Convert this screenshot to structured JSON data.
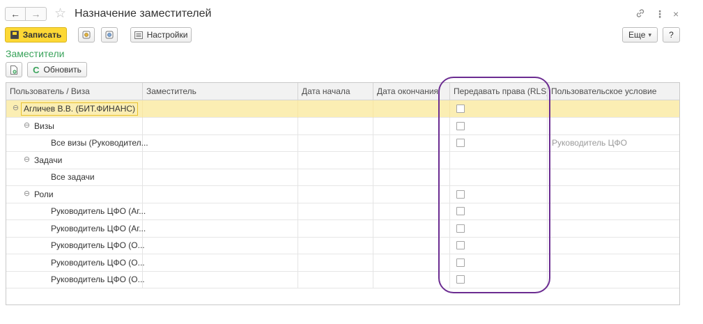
{
  "window": {
    "title": "Назначение заместителей",
    "back_icon": "←",
    "forward_icon": "→",
    "favorite_icon": "☆",
    "link_icon": "🔗",
    "menu_icon": "⋮",
    "close_icon": "×"
  },
  "toolbar": {
    "save_label": "Записать",
    "settings_label": "Настройки",
    "more_label": "Еще",
    "more_caret": "▾",
    "help_label": "?"
  },
  "section": {
    "title": "Заместители",
    "refresh_label": "Обновить",
    "refresh_icon": "C"
  },
  "table": {
    "columns": [
      "Пользователь / Виза",
      "Заместитель",
      "Дата начала",
      "Дата окончания",
      "Передавать права (RLS)",
      "Пользовательское условие"
    ],
    "collapse_icon": "⊖",
    "rows": [
      {
        "label": "Агличев В.В. (БИТ.ФИНАНС)",
        "level": 0,
        "collapse": true,
        "checkbox": true,
        "condition": "",
        "selected": true
      },
      {
        "label": "Визы",
        "level": 1,
        "collapse": true,
        "checkbox": true,
        "condition": "",
        "selected": false
      },
      {
        "label": "Все визы (Руководител...",
        "level": 2,
        "collapse": false,
        "checkbox": true,
        "condition": "Руководитель ЦФО",
        "selected": false
      },
      {
        "label": "Задачи",
        "level": 1,
        "collapse": true,
        "checkbox": false,
        "condition": "",
        "selected": false
      },
      {
        "label": "Все задачи",
        "level": 2,
        "collapse": false,
        "checkbox": false,
        "condition": "",
        "selected": false
      },
      {
        "label": "Роли",
        "level": 1,
        "collapse": true,
        "checkbox": true,
        "condition": "",
        "selected": false
      },
      {
        "label": "Руководитель ЦФО (Аг...",
        "level": 2,
        "collapse": false,
        "checkbox": true,
        "condition": "",
        "selected": false
      },
      {
        "label": "Руководитель ЦФО (Аг...",
        "level": 2,
        "collapse": false,
        "checkbox": true,
        "condition": "",
        "selected": false
      },
      {
        "label": "Руководитель ЦФО (О...",
        "level": 2,
        "collapse": false,
        "checkbox": true,
        "condition": "",
        "selected": false
      },
      {
        "label": "Руководитель ЦФО (О...",
        "level": 2,
        "collapse": false,
        "checkbox": true,
        "condition": "",
        "selected": false
      },
      {
        "label": "Руководитель ЦФО (О...",
        "level": 2,
        "collapse": false,
        "checkbox": true,
        "condition": "",
        "selected": false
      }
    ]
  },
  "colors": {
    "accent": "#fdd835",
    "section_title": "#3aa35b",
    "selected_row": "#fbeeb3",
    "highlight_outline": "#6b2c91"
  }
}
